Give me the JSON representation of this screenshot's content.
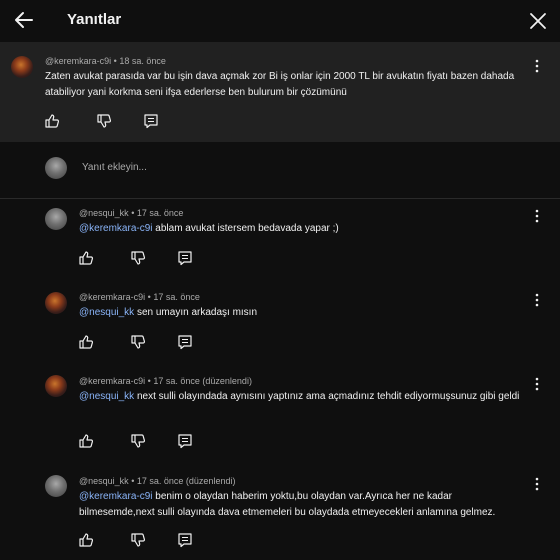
{
  "header": {
    "title": "Yanıtlar"
  },
  "parent_comment": {
    "author": "@keremkara-c9i",
    "time": "18 sa. önce",
    "text": "Zaten avukat parasıda var bu işin dava açmak zor Bi iş onlar için 2000 TL bir avukatın fiyatı bazen dahada atabiliyor yani korkma seni ifşa ederlerse ben bulurum bir çözümünü"
  },
  "reply_input": {
    "placeholder": "Yanıt ekleyin..."
  },
  "replies": [
    {
      "author": "@nesqui_kk",
      "time": "17 sa. önce",
      "edited": "",
      "mention": "@keremkara-c9i",
      "text": "ablam avukat istersem bedavada yapar ;)"
    },
    {
      "author": "@keremkara-c9i",
      "time": "17 sa. önce",
      "edited": "",
      "mention": "@nesqui_kk",
      "text": "sen umayın arkadaşı mısın"
    },
    {
      "author": "@keremkara-c9i",
      "time": "17 sa. önce",
      "edited": "(düzenlendi)",
      "mention": "@nesqui_kk",
      "text": "next sulli olayındada aynısını yaptınız ama açmadınız tehdit ediyormuşsunuz gibi geldi"
    },
    {
      "author": "@nesqui_kk",
      "time": "17 sa. önce",
      "edited": "(düzenlendi)",
      "mention": "@keremkara-c9i",
      "text": "benim o olaydan haberim yoktu,bu olaydan var.Ayrıca her ne kadar bilmesemde,next sulli olayında dava etmemeleri bu olaydada etmeyecekleri anlamına gelmez."
    }
  ],
  "separator": "•"
}
